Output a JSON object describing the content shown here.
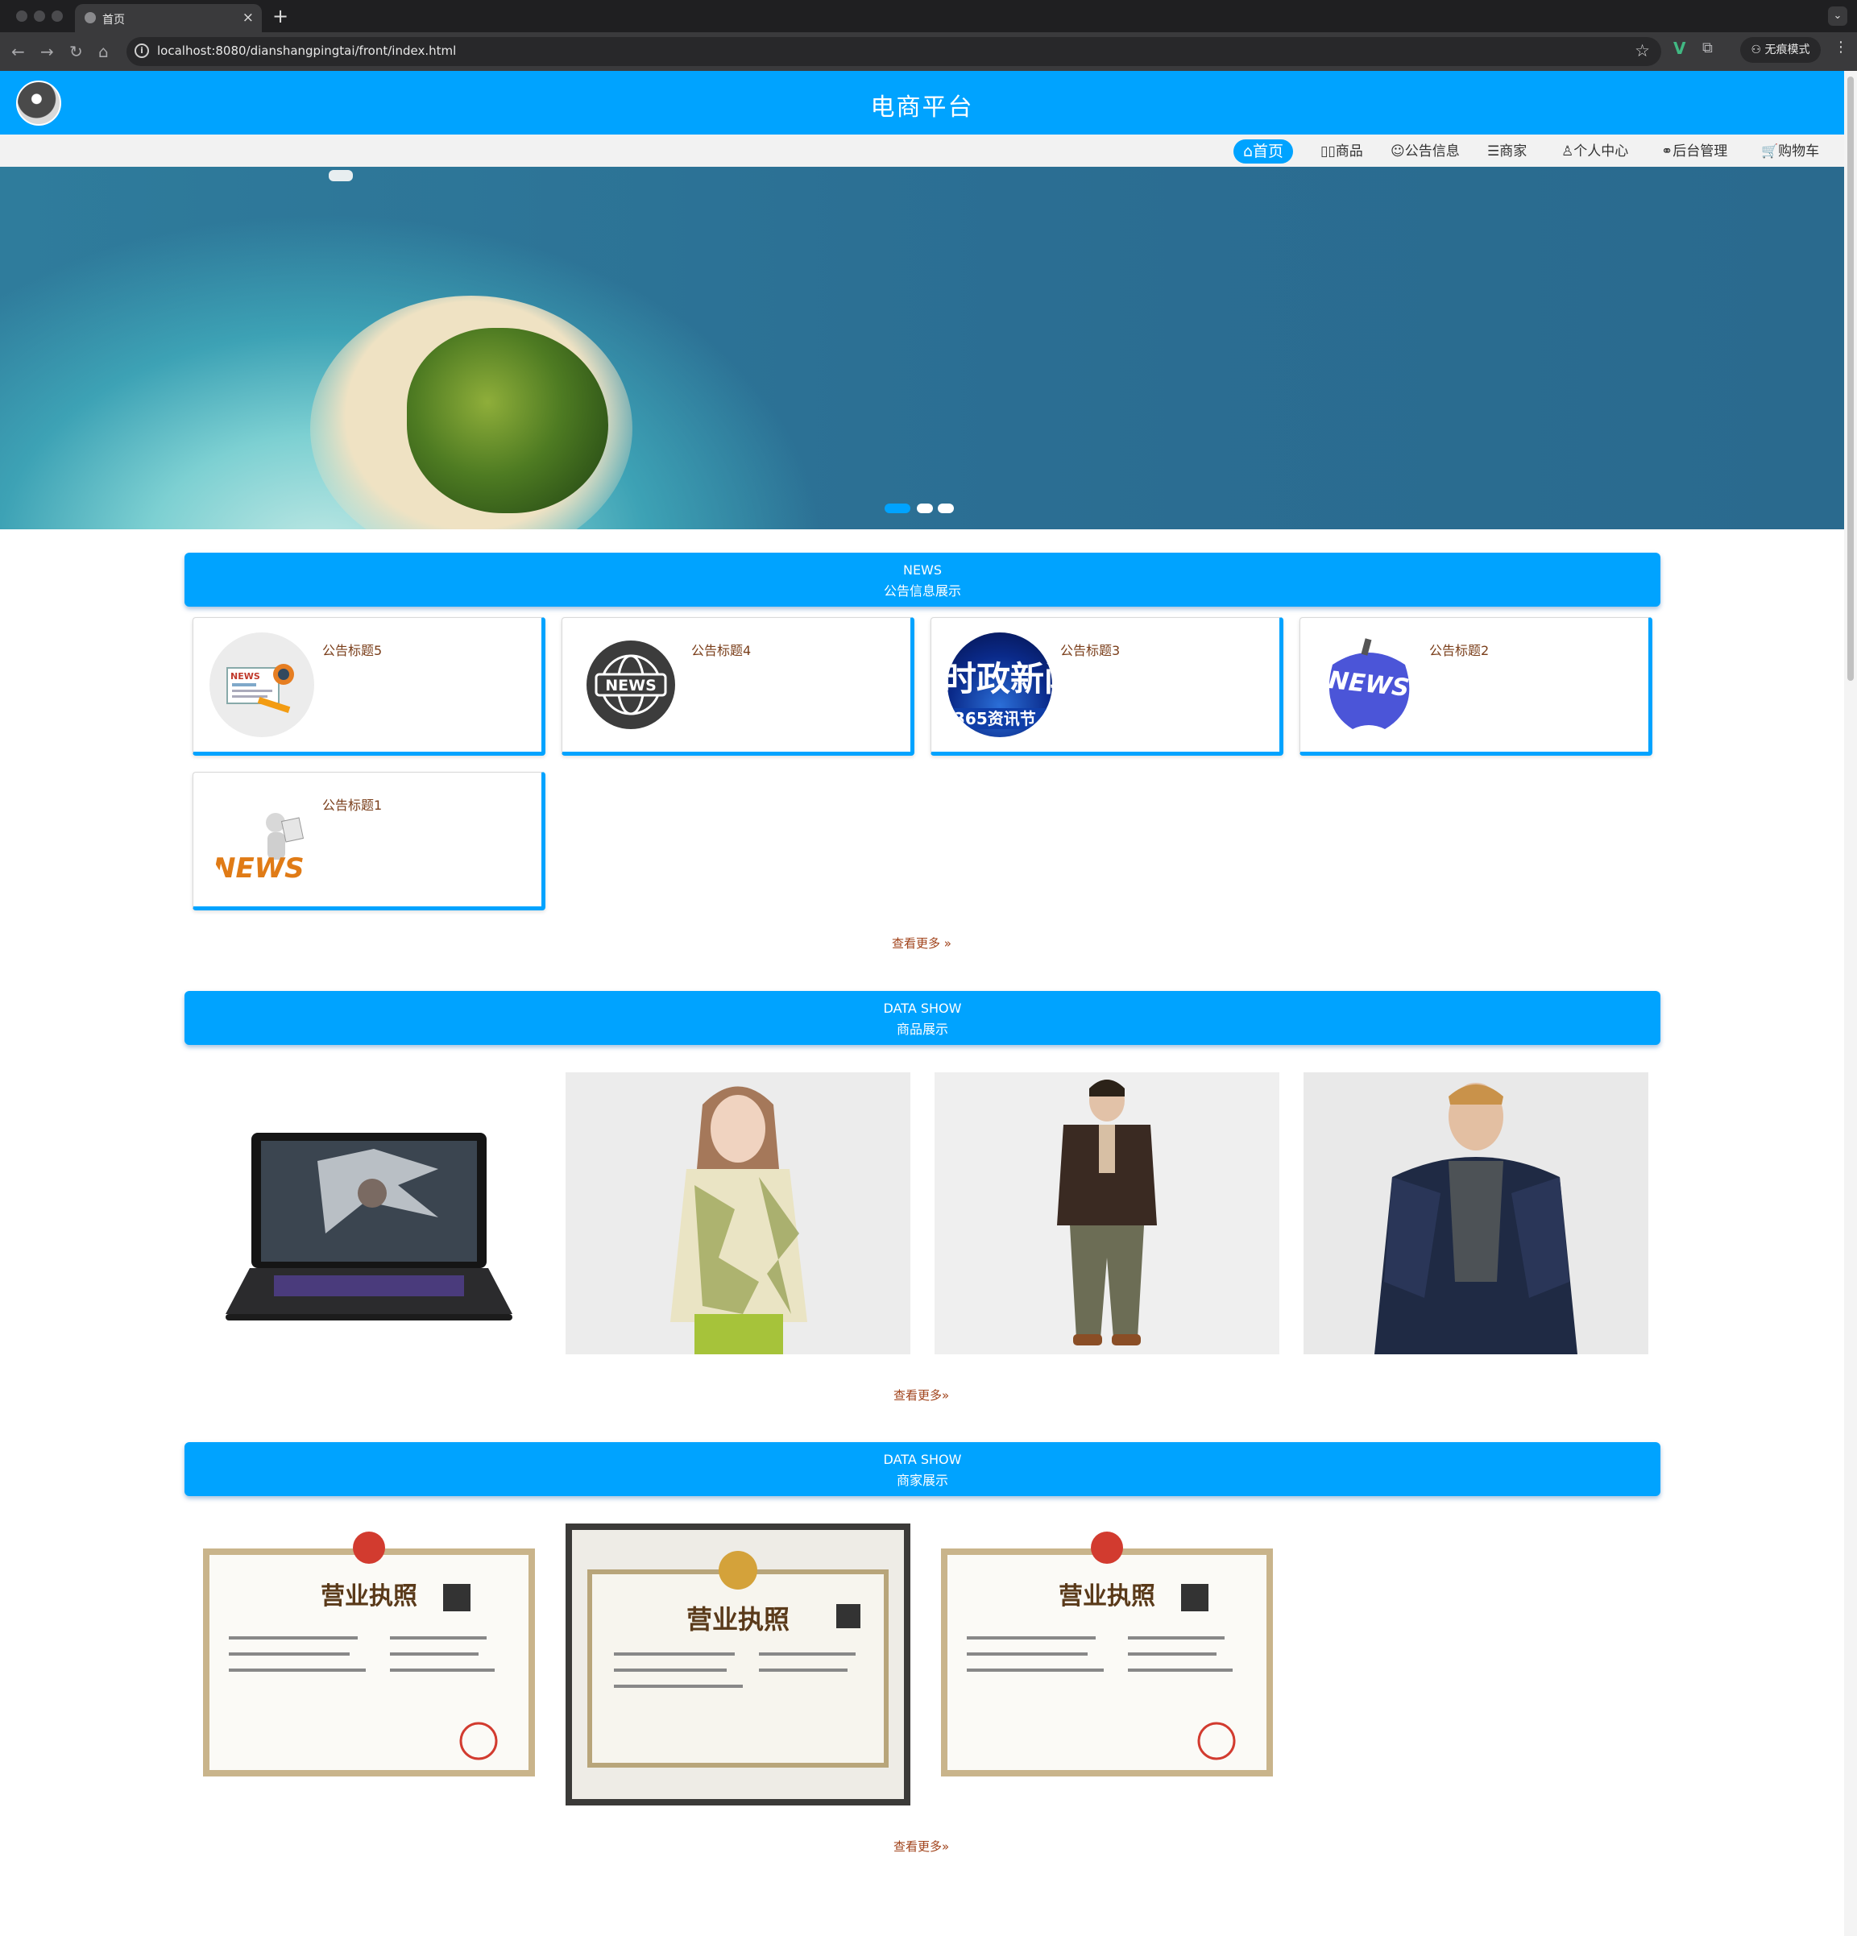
{
  "browser": {
    "tab_title": "首页",
    "url": "localhost:8080/dianshangpingtai/front/index.html",
    "incognito_label": "无痕模式"
  },
  "site": {
    "title": "电商平台"
  },
  "nav": [
    {
      "label": "⌂首页",
      "icon": "home-icon",
      "active": true
    },
    {
      "label": "▯▯商品",
      "icon": "goods-icon",
      "active": false
    },
    {
      "label": "☺公告信息",
      "icon": "notice-icon",
      "active": false
    },
    {
      "label": "☰商家",
      "icon": "merchant-icon",
      "active": false
    },
    {
      "label": "♙个人中心",
      "icon": "user-icon",
      "active": false
    },
    {
      "label": "⚭后台管理",
      "icon": "link-icon",
      "active": false
    },
    {
      "label": "🛒购物车",
      "icon": "cart-icon",
      "active": false
    }
  ],
  "banner": {
    "slide_count": 3,
    "active_slide": 1,
    "image": "heart-shaped island in turquoise sea"
  },
  "news_section": {
    "title_en": "NEWS",
    "title_cn": "公告信息展示",
    "items": [
      {
        "title": "公告标题5",
        "image": "news-newspaper-icon"
      },
      {
        "title": "公告标题4",
        "image": "news-globe-icon"
      },
      {
        "title": "公告标题3",
        "image": "political-news-image"
      },
      {
        "title": "公告标题2",
        "image": "news-apple-icon"
      },
      {
        "title": "公告标题1",
        "image": "news-3d-figure-icon"
      }
    ],
    "more_label": "查看更多 »"
  },
  "goods_section": {
    "title_en": "DATA SHOW",
    "title_cn": "商品展示",
    "items": [
      {
        "image": "laptop-photo"
      },
      {
        "image": "woman-floral-top-photo"
      },
      {
        "image": "man-brown-jacket-photo"
      },
      {
        "image": "man-quilted-jacket-photo"
      }
    ],
    "more_label": "查看更多»"
  },
  "merchant_section": {
    "title_en": "DATA SHOW",
    "title_cn": "商家展示",
    "items": [
      {
        "image": "business-license-photo",
        "heading": "营业执照"
      },
      {
        "image": "business-license-photo",
        "heading": "营业执照"
      },
      {
        "image": "business-license-photo",
        "heading": "营业执照"
      }
    ],
    "more_label": "查看更多»"
  }
}
